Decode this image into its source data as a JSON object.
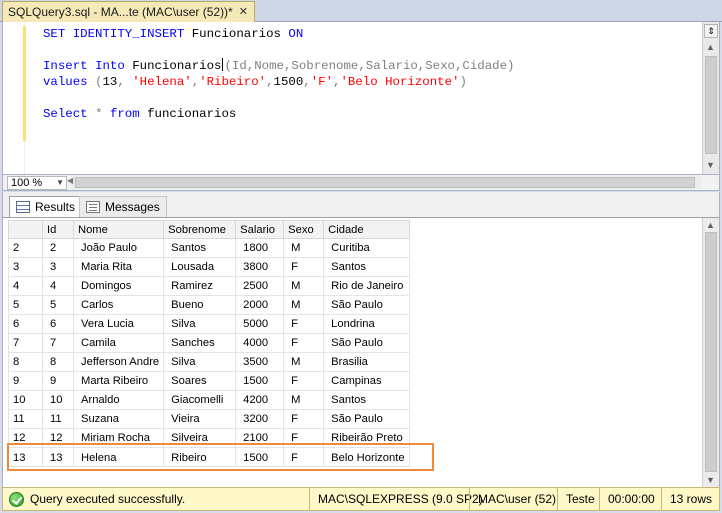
{
  "tab": {
    "title": "SQLQuery3.sql - MA...te (MAC\\user (52))*",
    "close": "✕"
  },
  "editor": {
    "line1": {
      "kw1": "SET",
      "kw2": "IDENTITY_INSERT",
      "table": "Funcionarios",
      "kw3": "ON"
    },
    "line3": {
      "kw1": "Insert",
      "kw2": "Into",
      "table": "Funcionarios",
      "cols": "(Id,Nome,Sobrenome,Salario,Sexo,Cidade)"
    },
    "line4": {
      "kw": "values",
      "open": "(",
      "n1": "13",
      "c1": ", ",
      "s1": "'Helena'",
      "c2": ",",
      "s2": "'Ribeiro'",
      "c3": ",",
      "n2": "1500",
      "c4": ",",
      "s3": "'F'",
      "c5": ",",
      "s4": "'Belo Horizonte'",
      "close": ")"
    },
    "line6": {
      "kw1": "Select",
      "star": "*",
      "kw2": "from",
      "table": "funcionarios"
    }
  },
  "zoom": {
    "value": "100 %"
  },
  "result_tabs": {
    "results": "Results",
    "messages": "Messages"
  },
  "grid": {
    "columns": [
      "",
      "Id",
      "Nome",
      "Sobrenome",
      "Salario",
      "Sexo",
      "Cidade"
    ],
    "rows": [
      [
        "2",
        "2",
        "João Paulo",
        "Santos",
        "1800",
        "M",
        "Curitiba"
      ],
      [
        "3",
        "3",
        "Maria Rita",
        "Lousada",
        "3800",
        "F",
        "Santos"
      ],
      [
        "4",
        "4",
        "Domingos",
        "Ramirez",
        "2500",
        "M",
        "Rio de Janeiro"
      ],
      [
        "5",
        "5",
        "Carlos",
        "Bueno",
        "2000",
        "M",
        "São Paulo"
      ],
      [
        "6",
        "6",
        "Vera Lucia",
        "Silva",
        "5000",
        "F",
        "Londrina"
      ],
      [
        "7",
        "7",
        "Camila",
        "Sanches",
        "4000",
        "F",
        "São Paulo"
      ],
      [
        "8",
        "8",
        "Jefferson Andre",
        "Silva",
        "3500",
        "M",
        "Brasilia"
      ],
      [
        "9",
        "9",
        "Marta Ribeiro",
        "Soares",
        "1500",
        "F",
        "Campinas"
      ],
      [
        "10",
        "10",
        "Arnaldo",
        "Giacomelli",
        "4200",
        "M",
        "Santos"
      ],
      [
        "11",
        "11",
        "Suzana",
        "Vieira",
        "3200",
        "F",
        "São Paulo"
      ],
      [
        "12",
        "12",
        "Miriam Rocha",
        "Silveira",
        "2100",
        "F",
        "Ribeirão Preto"
      ],
      [
        "13",
        "13",
        "Helena",
        "Ribeiro",
        "1500",
        "F",
        "Belo Horizonte"
      ]
    ]
  },
  "status": {
    "message": "Query executed successfully.",
    "server": "MAC\\SQLEXPRESS (9.0 SP2)",
    "user": "MAC\\user (52)",
    "database": "Teste",
    "elapsed": "00:00:00",
    "rows": "13 rows"
  },
  "colors": {
    "highlight": "#f08a36",
    "keyword": "#0000ff",
    "string": "#ff0000",
    "status_bg": "#fff8c8"
  }
}
